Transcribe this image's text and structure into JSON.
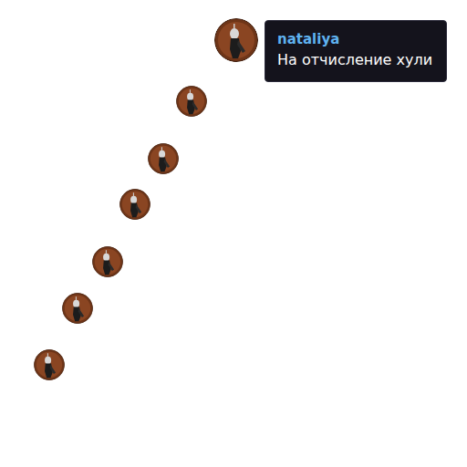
{
  "message": {
    "author": "nataliya",
    "text": "На отчисление хули"
  }
}
